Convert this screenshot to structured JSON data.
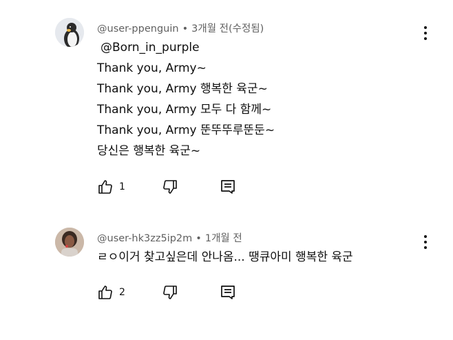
{
  "comments": [
    {
      "author": "@user-ppenguin",
      "time": "3개월 전(수정됨)",
      "lines": [
        "@Born_in_purple",
        "Thank you, Army~",
        "Thank you, Army 행복한 육군~",
        "Thank you, Army 모두 다 함께~",
        "Thank you, Army 뚠뚜뚜루뚠둔~",
        "당신은 행복한 육군~"
      ],
      "likes": "1",
      "avatar_icon": "penguin-avatar",
      "avatar_color": "#dfe3e8"
    },
    {
      "author": "@user-hk3zz5ip2m",
      "time": "1개월 전",
      "lines": [
        "ㄹㅇ이거 찾고싶은데 안나옴... 땡큐아미 행복한 육군"
      ],
      "likes": "2",
      "avatar_icon": "person-avatar",
      "avatar_color": "#b9a79a"
    }
  ],
  "separator": "•",
  "icons": [
    "like-icon",
    "dislike-icon",
    "reply-icon",
    "more-options-icon"
  ]
}
